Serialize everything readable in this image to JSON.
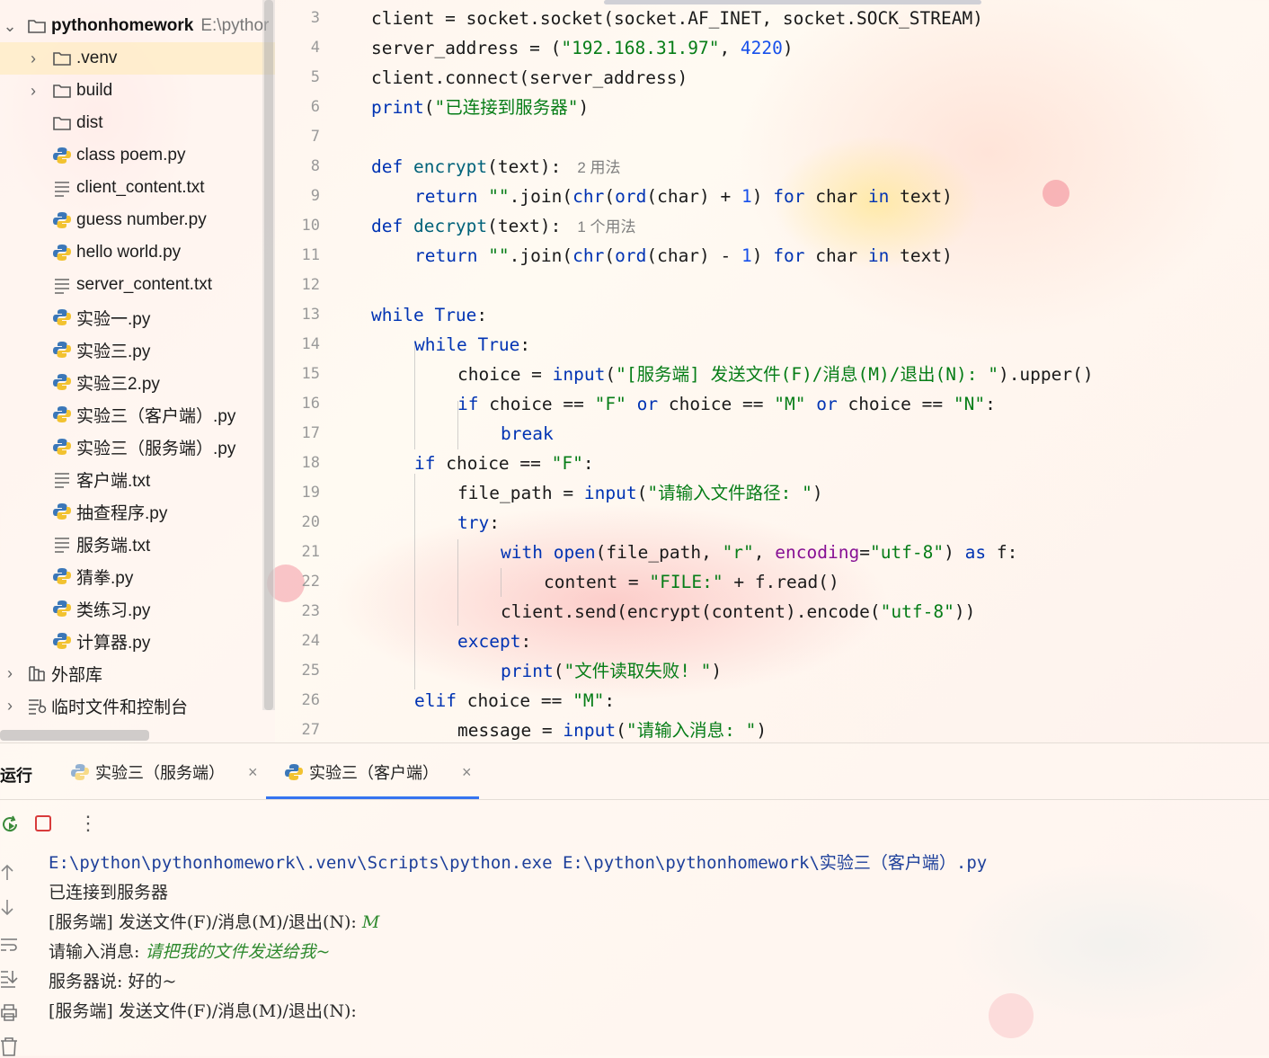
{
  "project": {
    "root_name": "pythonhomework",
    "root_path": "E:\\pythor",
    "items": [
      {
        "label": ".venv",
        "kind": "folder",
        "expandable": true
      },
      {
        "label": "build",
        "kind": "folder",
        "expandable": true
      },
      {
        "label": "dist",
        "kind": "folder",
        "expandable": false
      },
      {
        "label": "class poem.py",
        "kind": "python"
      },
      {
        "label": "client_content.txt",
        "kind": "text"
      },
      {
        "label": "guess number.py",
        "kind": "python"
      },
      {
        "label": "hello world.py",
        "kind": "python"
      },
      {
        "label": "server_content.txt",
        "kind": "text"
      },
      {
        "label": "实验一.py",
        "kind": "python"
      },
      {
        "label": "实验三.py",
        "kind": "python"
      },
      {
        "label": "实验三2.py",
        "kind": "python"
      },
      {
        "label": "实验三（客户端）.py",
        "kind": "python"
      },
      {
        "label": "实验三（服务端）.py",
        "kind": "python"
      },
      {
        "label": "客户端.txt",
        "kind": "text"
      },
      {
        "label": "抽查程序.py",
        "kind": "python"
      },
      {
        "label": "服务端.txt",
        "kind": "text"
      },
      {
        "label": "猜拳.py",
        "kind": "python"
      },
      {
        "label": "类练习.py",
        "kind": "python"
      },
      {
        "label": "计算器.py",
        "kind": "python"
      }
    ],
    "external_libraries": "外部库",
    "scratches": "临时文件和控制台"
  },
  "editor": {
    "line_numbers": [
      "3",
      "4",
      "5",
      "6",
      "7",
      "8",
      "9",
      "10",
      "11",
      "12",
      "13",
      "14",
      "15",
      "16",
      "17",
      "18",
      "19",
      "20",
      "21",
      "22",
      "23",
      "24",
      "25",
      "26",
      "27"
    ],
    "usage_hint_encrypt": "2 用法",
    "usage_hint_decrypt": "1 个用法",
    "code": {
      "l3": [
        "client = socket.socket(socket.AF_INET, socket.SOCK_STREAM)"
      ],
      "l4": [
        "server_address = (",
        "\"192.168.31.97\"",
        ", ",
        "4220",
        ")"
      ],
      "l5": [
        "client.connect(server_address)"
      ],
      "l6": [
        "print",
        "(",
        "\"已连接到服务器\"",
        ")"
      ],
      "l8": [
        "def ",
        "encrypt",
        "(text):"
      ],
      "l9": [
        "return ",
        "\"\"",
        ".join(",
        "chr",
        "(",
        "ord",
        "(char) + ",
        "1",
        ") ",
        "for ",
        "char ",
        "in ",
        "text)"
      ],
      "l10": [
        "def ",
        "decrypt",
        "(text):"
      ],
      "l11": [
        "return ",
        "\"\"",
        ".join(",
        "chr",
        "(",
        "ord",
        "(char) - ",
        "1",
        ") ",
        "for ",
        "char ",
        "in ",
        "text)"
      ],
      "l13": [
        "while ",
        "True",
        ":"
      ],
      "l14": [
        "while ",
        "True",
        ":"
      ],
      "l15": [
        "choice = ",
        "input",
        "(",
        "\"[服务端] 发送文件(F)/消息(M)/退出(N): \"",
        ").upper()"
      ],
      "l16": [
        "if ",
        "choice == ",
        "\"F\"",
        " or ",
        "choice == ",
        "\"M\"",
        " or ",
        "choice == ",
        "\"N\"",
        ":"
      ],
      "l17": [
        "break"
      ],
      "l18": [
        "if ",
        "choice == ",
        "\"F\"",
        ":"
      ],
      "l19": [
        "file_path = ",
        "input",
        "(",
        "\"请输入文件路径: \"",
        ")"
      ],
      "l20": [
        "try",
        ":"
      ],
      "l21": [
        "with ",
        "open",
        "(file_path, ",
        "\"r\"",
        ", ",
        "encoding",
        "=",
        "\"utf-8\"",
        ") ",
        "as ",
        "f:"
      ],
      "l22": [
        "content = ",
        "\"FILE:\"",
        " + f.read()"
      ],
      "l23": [
        "client.send(encrypt(content).encode(",
        "\"utf-8\"",
        "))"
      ],
      "l24": [
        "except",
        ":"
      ],
      "l25": [
        "print",
        "(",
        "\"文件读取失败! \"",
        ")"
      ],
      "l26": [
        "elif ",
        "choice == ",
        "\"M\"",
        ":"
      ],
      "l27": [
        "message = ",
        "input",
        "(",
        "\"请输入消息: \"",
        ")"
      ]
    }
  },
  "run": {
    "title": "运行",
    "tabs": [
      {
        "label": "实验三（服务端）",
        "active": false
      },
      {
        "label": "实验三（客户端）",
        "active": true
      }
    ],
    "console": {
      "command": "E:\\python\\pythonhomework\\.venv\\Scripts\\python.exe E:\\python\\pythonhomework\\实验三（客户端）.py",
      "lines": [
        {
          "prompt": "已连接到服务器",
          "input": ""
        },
        {
          "prompt": "[服务端] 发送文件(F)/消息(M)/退出(N): ",
          "input": "M"
        },
        {
          "prompt": "请输入消息: ",
          "input": "请把我的文件发送给我~"
        },
        {
          "prompt": "服务器说: 好的~",
          "input": ""
        },
        {
          "prompt": "[服务端] 发送文件(F)/消息(M)/退出(N): ",
          "input": ""
        }
      ]
    }
  },
  "colors": {
    "keyword": "#0033b3",
    "string": "#067d17",
    "number": "#1750eb",
    "accent": "#3574f0",
    "console_input": "#2f8a2f"
  }
}
